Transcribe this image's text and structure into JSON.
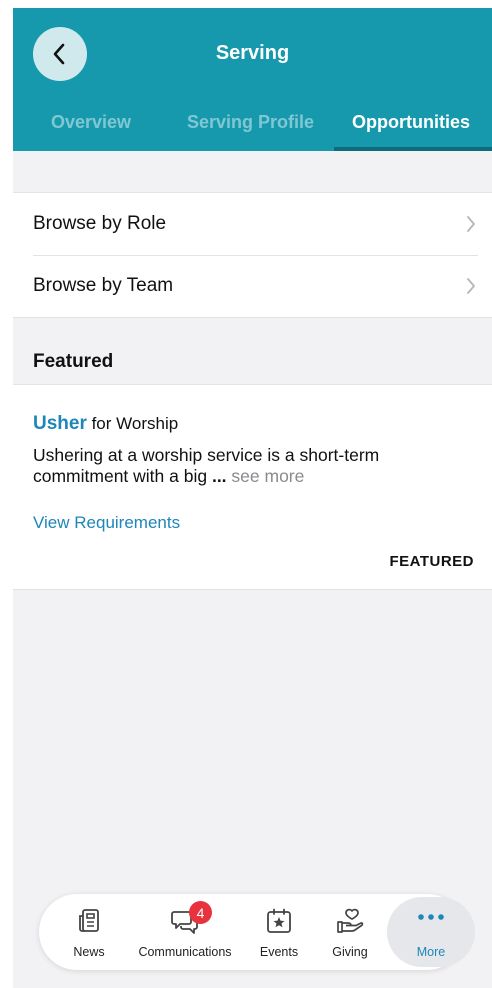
{
  "header": {
    "title": "Serving",
    "back_label": "Back"
  },
  "tabs": [
    {
      "label": "Overview",
      "active": false
    },
    {
      "label": "Serving Profile",
      "active": false
    },
    {
      "label": "Opportunities",
      "active": true
    }
  ],
  "browse": {
    "items": [
      {
        "label": "Browse by Role"
      },
      {
        "label": "Browse by Team"
      }
    ]
  },
  "featured": {
    "section_title": "Featured",
    "card": {
      "role": "Usher",
      "team_prefix": " for Worship",
      "description": "Ushering at a worship service is a short-term commitment with a big ",
      "ellipsis": "...",
      "see_more": " see more",
      "view_requirements": "View Requirements",
      "badge": "FEATURED"
    }
  },
  "tabbar": {
    "items": [
      {
        "label": "News",
        "icon": "news-icon"
      },
      {
        "label": "Communications",
        "icon": "chat-icon",
        "badge": "4"
      },
      {
        "label": "Events",
        "icon": "calendar-star-icon"
      },
      {
        "label": "Giving",
        "icon": "heart-hand-icon"
      },
      {
        "label": "More",
        "icon": "more-dots-icon",
        "active": true
      }
    ]
  },
  "colors": {
    "header_bg": "#1699ad",
    "accent": "#1f86b8",
    "badge": "#e8333f"
  }
}
